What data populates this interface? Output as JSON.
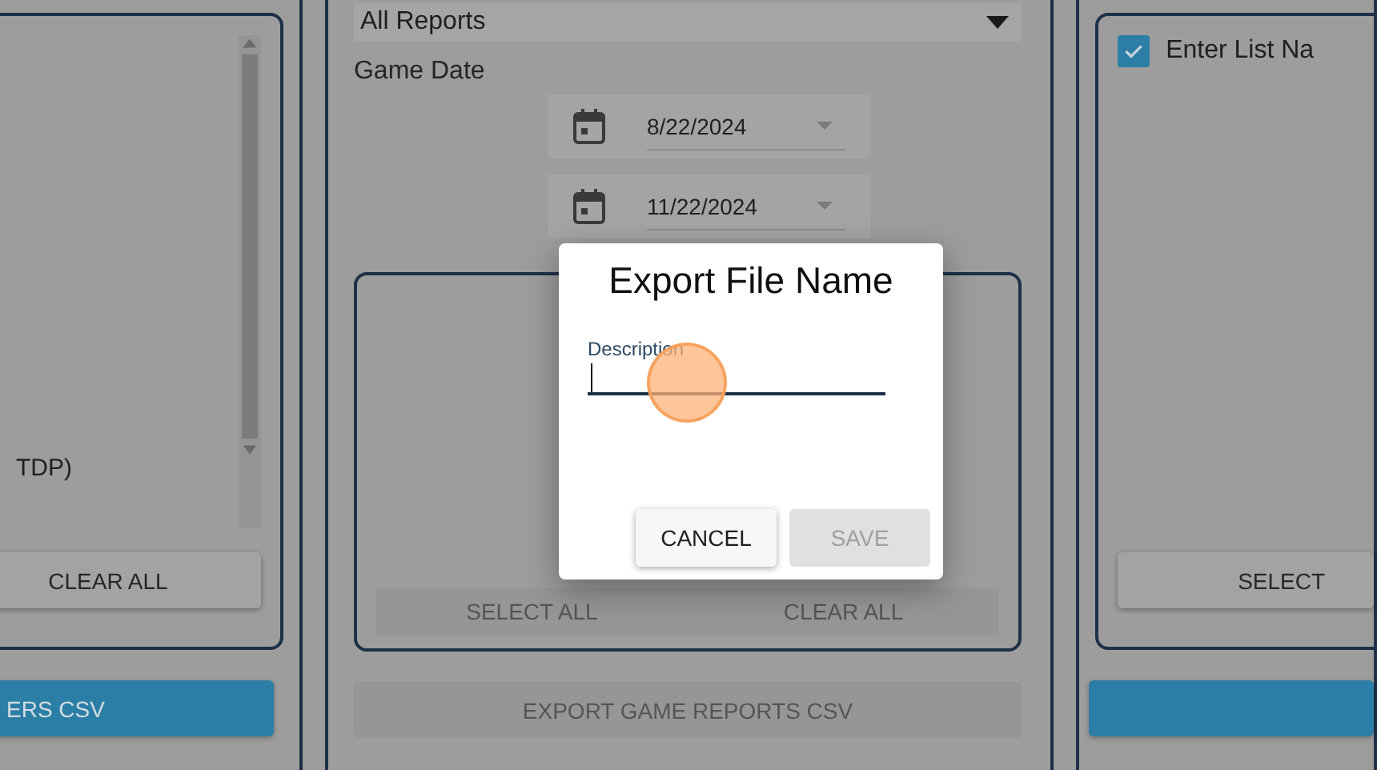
{
  "left_panel": {
    "list_items": [
      {
        "label": "TDP)"
      }
    ],
    "buttons": [
      {
        "label": "CLEAR ALL",
        "disabled": false
      }
    ],
    "export_button": {
      "label": "ERS CSV",
      "disabled": false
    }
  },
  "middle_panel": {
    "report_select": {
      "value": "All Reports"
    },
    "game_date_label": "Game Date",
    "dates": [
      {
        "value": "8/22/2024"
      },
      {
        "value": "11/22/2024"
      }
    ],
    "buttons": [
      {
        "label": "SELECT ALL",
        "disabled": true
      },
      {
        "label": "CLEAR ALL",
        "disabled": true
      }
    ],
    "export_button": {
      "label": "EXPORT GAME REPORTS CSV",
      "disabled": true
    }
  },
  "right_panel": {
    "list_items": [
      {
        "label": "Enter List Na",
        "checked": true
      }
    ],
    "buttons": [
      {
        "label": "SELECT",
        "disabled": false
      }
    ],
    "export_button": {
      "disabled": false
    }
  },
  "dialog": {
    "title": "Export File Name",
    "field": {
      "label": "Description",
      "focused": true
    },
    "buttons": [
      {
        "label": "CANCEL",
        "disabled": false
      },
      {
        "label": "SAVE",
        "disabled": true
      }
    ]
  }
}
